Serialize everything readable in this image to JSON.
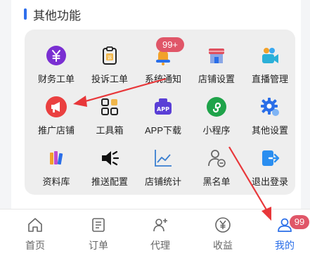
{
  "section": {
    "title": "其他功能"
  },
  "grid": {
    "items": [
      {
        "label": "财务工单",
        "icon": "yen-circle-icon"
      },
      {
        "label": "投诉工单",
        "icon": "complaint-clipboard-icon"
      },
      {
        "label": "系统通知",
        "icon": "bell-icon",
        "badge": "99+"
      },
      {
        "label": "店铺设置",
        "icon": "store-icon"
      },
      {
        "label": "直播管理",
        "icon": "video-camera-icon"
      },
      {
        "label": "推广店铺",
        "icon": "megaphone-icon"
      },
      {
        "label": "工具箱",
        "icon": "toolbox-grid-icon"
      },
      {
        "label": "APP下载",
        "icon": "app-download-icon"
      },
      {
        "label": "小程序",
        "icon": "mini-program-icon"
      },
      {
        "label": "其他设置",
        "icon": "gear-icon"
      },
      {
        "label": "资料库",
        "icon": "books-icon"
      },
      {
        "label": "推送配置",
        "icon": "speaker-icon"
      },
      {
        "label": "店铺统计",
        "icon": "line-chart-icon"
      },
      {
        "label": "黑名单",
        "icon": "user-block-icon"
      },
      {
        "label": "退出登录",
        "icon": "logout-icon"
      }
    ]
  },
  "tabbar": {
    "tabs": [
      {
        "label": "首页",
        "icon": "home-icon"
      },
      {
        "label": "订单",
        "icon": "order-list-icon"
      },
      {
        "label": "代理",
        "icon": "user-add-icon"
      },
      {
        "label": "收益",
        "icon": "yen-circle-icon"
      },
      {
        "label": "我的",
        "icon": "user-icon",
        "badge": "99",
        "active": true
      }
    ]
  },
  "colors": {
    "accent": "#2a6ee8",
    "badge": "#e05668",
    "annotation_arrow": "#e8373a"
  }
}
